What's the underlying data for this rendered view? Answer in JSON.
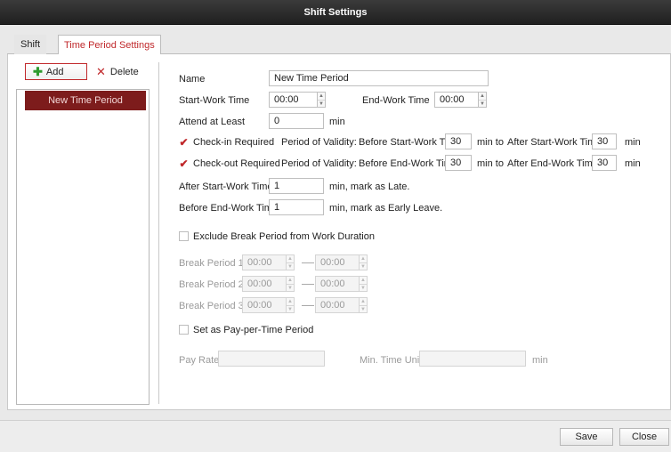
{
  "window": {
    "title": "Shift Settings"
  },
  "tabs": [
    {
      "label": "Shift"
    },
    {
      "label": "Time Period Settings"
    }
  ],
  "toolbar": {
    "add_label": "Add",
    "delete_label": "Delete"
  },
  "list": {
    "items": [
      {
        "label": "New Time Period"
      }
    ]
  },
  "form": {
    "name_label": "Name",
    "name_value": "New Time Period",
    "start_label": "Start-Work Time",
    "start_value": "00:00",
    "end_label": "End-Work Time",
    "end_value": "00:00",
    "attend_label": "Attend at Least",
    "attend_value": "0",
    "attend_unit": "min",
    "checkin": {
      "checked": true,
      "label": "Check-in Required",
      "validity_label": "Period of Validity:",
      "before_label": "Before Start-Work Time",
      "before_value": "30",
      "min_to": "min  to",
      "after_label": "After Start-Work Time",
      "after_value": "30",
      "unit": "min"
    },
    "checkout": {
      "checked": true,
      "label": "Check-out Required",
      "validity_label": "Period of Validity:",
      "before_label": "Before End-Work Time",
      "before_value": "30",
      "min_to": "min  to",
      "after_label": "After End-Work Time",
      "after_value": "30",
      "unit": "min"
    },
    "late_label": "After Start-Work Time",
    "late_value": "1",
    "late_suffix": "min, mark as Late.",
    "early_label": "Before End-Work Time",
    "early_value": "1",
    "early_suffix": "min, mark as Early Leave.",
    "exclude_break": {
      "checked": false,
      "label": "Exclude Break Period from Work Duration"
    },
    "breaks": [
      {
        "label": "Break Period  1",
        "start": "00:00",
        "end": "00:00"
      },
      {
        "label": "Break Period  2",
        "start": "00:00",
        "end": "00:00"
      },
      {
        "label": "Break Period  3",
        "start": "00:00",
        "end": "00:00"
      }
    ],
    "pay_per_time": {
      "checked": false,
      "label": "Set as Pay-per-Time Period"
    },
    "pay_rate_label": "Pay Rate",
    "pay_rate_value": "",
    "min_unit_label": "Min. Time Unit",
    "min_unit_value": "",
    "min_unit_suffix": "min"
  },
  "footer": {
    "save_label": "Save",
    "close_label": "Close"
  },
  "colors": {
    "accent": "#c0282b",
    "selected_item": "#7d1c1c",
    "add_icon": "#2e9b2e"
  }
}
